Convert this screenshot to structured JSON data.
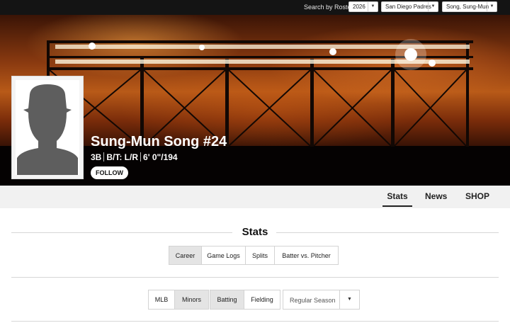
{
  "roster_bar": {
    "label": "Search by Roster",
    "year": "2026",
    "team": "San Diego Padres",
    "player": "Song, Sung-Mun",
    "dropdown_icon": "caret-down-icon"
  },
  "player": {
    "name": "Sung-Mun Song #24",
    "position": "3B",
    "bats_throws": "B/T: L/R",
    "height_weight": "6' 0\"/194",
    "follow_label": "FOLLOW"
  },
  "nav": {
    "tabs": [
      {
        "label": "Stats",
        "active": true
      },
      {
        "label": "News",
        "active": false
      },
      {
        "label": "SHOP",
        "active": false
      }
    ]
  },
  "stats": {
    "title": "Stats",
    "view_tabs": [
      {
        "label": "Career",
        "active": true
      },
      {
        "label": "Game Logs",
        "active": false
      },
      {
        "label": "Splits",
        "active": false
      },
      {
        "label": "Batter vs. Pitcher",
        "active": false
      }
    ],
    "level_toggle": [
      {
        "label": "MLB",
        "active": false
      },
      {
        "label": "Minors",
        "active": true
      }
    ],
    "type_toggle": [
      {
        "label": "Batting",
        "active": true
      },
      {
        "label": "Fielding",
        "active": false
      }
    ],
    "season_select": {
      "value": "Regular Season"
    }
  },
  "colors": {
    "topbar": "#141414",
    "nav_bg": "#f1f1f1",
    "active_tab_bg": "#e4e4e4"
  }
}
